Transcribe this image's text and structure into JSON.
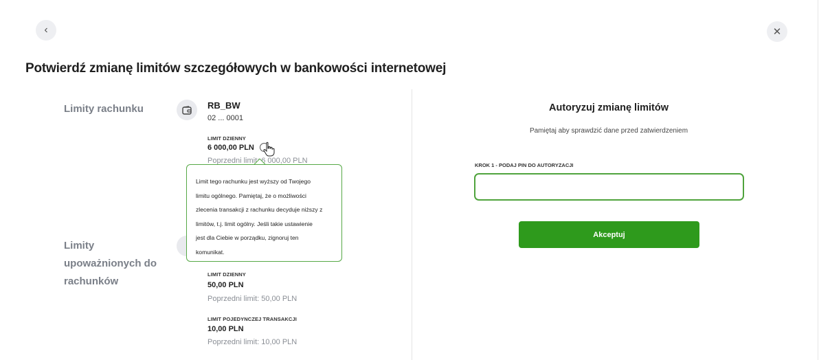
{
  "header": {
    "back_icon": "chevron-left-icon",
    "back_glyph": "‹",
    "close_icon": "close-icon",
    "close_glyph": "✕",
    "title": "Potwierdź zmianę limitów szczegółowych w bankowości internetowej"
  },
  "account_limits": {
    "section_label": "Limity rachunku",
    "account_name": "RB_BW",
    "account_number": "02 ... 0001",
    "daily_limit_label": "LIMIT DZIENNY",
    "daily_limit_value": "6 000,00 PLN",
    "previous_limit_text": "Poprzedni limit: 6 000,00 PLN"
  },
  "tooltip": {
    "text_lines": [
      "Limit tego rachunku jest wyższy od Twojego",
      "limitu ogólnego. Pamiętaj, że o możliwości",
      "zlecenia transakcji z rachunku decyduje niższy z",
      "limitów, t.j. limit ogólny. Jeśli takie ustawienie",
      "jest dla Ciebie w porządku, zignoruj ten",
      "komunikat."
    ]
  },
  "authorized_limits": {
    "section_label_lines": [
      "Limity",
      "upoważnionych do",
      "rachunków"
    ],
    "daily_limit_label": "LIMIT DZIENNY",
    "daily_limit_value": "50,00 PLN",
    "daily_previous": "Poprzedni limit: 50,00 PLN",
    "single_tx_label": "LIMIT POJEDYNCZEJ TRANSAKCJI",
    "single_tx_value": "10,00 PLN",
    "single_tx_previous": "Poprzedni limit: 10,00 PLN"
  },
  "authorization": {
    "title": "Autoryzuj zmianę limitów",
    "subtitle": "Pamiętaj aby sprawdzić dane przed zatwierdzeniem",
    "pin_label": "KROK 1 - PODAJ PIN DO AUTORYZACJI",
    "pin_value": "",
    "accept_label": "Akceptuj"
  },
  "colors": {
    "accent_green": "#2e9a1c",
    "input_border_green": "#4fa33c",
    "section_label_gray": "#7a7f88"
  }
}
